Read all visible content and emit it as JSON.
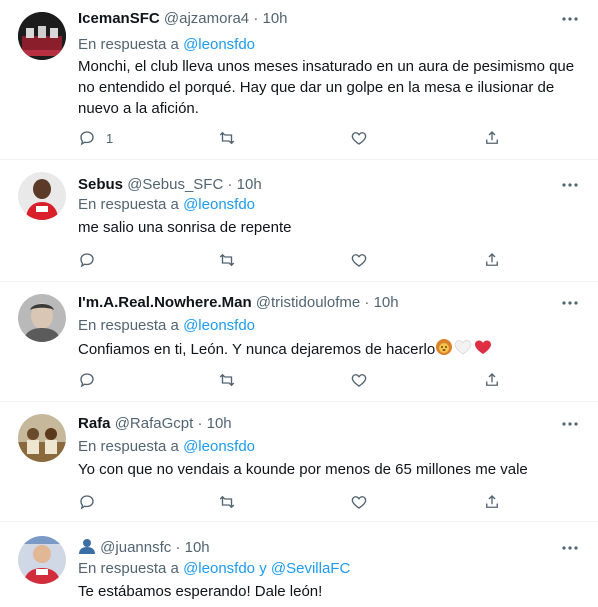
{
  "reply_prefix": "En respuesta a",
  "tweets": [
    {
      "name": "IcemanSFC",
      "handle": "@ajzamora4",
      "time": "10h",
      "reply_to": "@leonsfdo",
      "text": "Monchi, el club lleva unos meses insaturado en un aura de pesimismo que no entendido el porqué. Hay que dar un golpe en la mesa e ilusionar de nuevo a la afición.",
      "reply_count": "1"
    },
    {
      "name": "Sebus",
      "handle": "@Sebus_SFC",
      "time": "10h",
      "reply_to": "@leonsfdo",
      "text": "me salio una sonrisa de repente",
      "reply_count": ""
    },
    {
      "name": "I'm.A.Real.Nowhere.Man",
      "handle": "@tristidoulofme",
      "time": "10h",
      "reply_to": "@leonsfdo",
      "text": "Confiamos en ti, León. Y nunca dejaremos de hacerlo",
      "reply_count": ""
    },
    {
      "name": "Rafa",
      "handle": "@RafaGcpt",
      "time": "10h",
      "reply_to": "@leonsfdo",
      "text": "Yo con que no vendais a kounde por menos de 65 millones me vale",
      "reply_count": ""
    },
    {
      "name": "",
      "handle": "@juannsfc",
      "time": "10h",
      "reply_to": "@leonsfdo",
      "reply_to_extra": "y @SevillaFC",
      "text": "Te estábamos esperando! Dale león!",
      "reply_count": ""
    }
  ],
  "icons": [
    "reply-icon",
    "retweet-icon",
    "like-icon",
    "share-icon",
    "more-icon",
    "lion-emoji",
    "white-heart-emoji",
    "red-heart-emoji",
    "person-emoji"
  ],
  "colors": {
    "link": "#1d9bf0",
    "muted": "#536471",
    "text": "#0f1419",
    "divider": "#eff3f4"
  }
}
